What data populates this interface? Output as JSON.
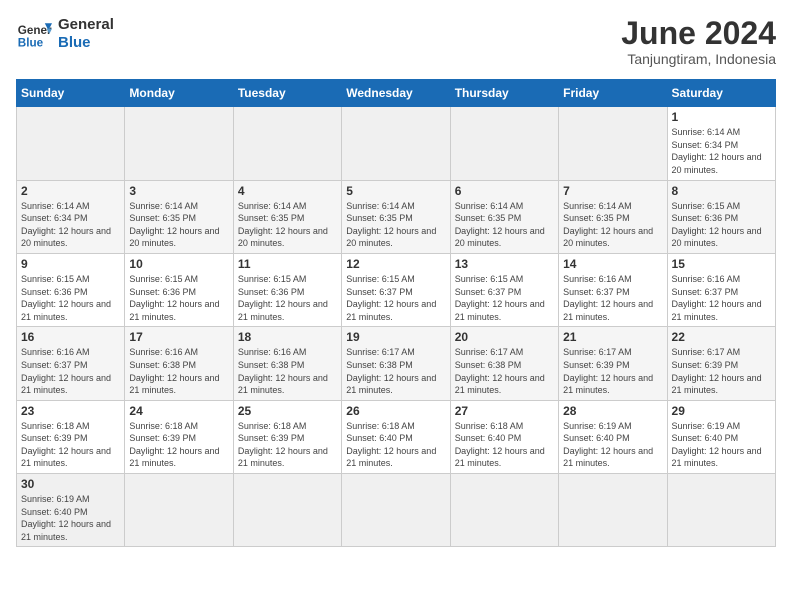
{
  "logo": {
    "general": "General",
    "blue": "Blue"
  },
  "title": "June 2024",
  "subtitle": "Tanjungtiram, Indonesia",
  "days_of_week": [
    "Sunday",
    "Monday",
    "Tuesday",
    "Wednesday",
    "Thursday",
    "Friday",
    "Saturday"
  ],
  "weeks": [
    {
      "days": [
        {
          "num": "",
          "info": ""
        },
        {
          "num": "",
          "info": ""
        },
        {
          "num": "",
          "info": ""
        },
        {
          "num": "",
          "info": ""
        },
        {
          "num": "",
          "info": ""
        },
        {
          "num": "",
          "info": ""
        },
        {
          "num": "1",
          "info": "Sunrise: 6:14 AM\nSunset: 6:34 PM\nDaylight: 12 hours and 20 minutes."
        }
      ]
    },
    {
      "days": [
        {
          "num": "2",
          "info": "Sunrise: 6:14 AM\nSunset: 6:34 PM\nDaylight: 12 hours and 20 minutes."
        },
        {
          "num": "3",
          "info": "Sunrise: 6:14 AM\nSunset: 6:35 PM\nDaylight: 12 hours and 20 minutes."
        },
        {
          "num": "4",
          "info": "Sunrise: 6:14 AM\nSunset: 6:35 PM\nDaylight: 12 hours and 20 minutes."
        },
        {
          "num": "5",
          "info": "Sunrise: 6:14 AM\nSunset: 6:35 PM\nDaylight: 12 hours and 20 minutes."
        },
        {
          "num": "6",
          "info": "Sunrise: 6:14 AM\nSunset: 6:35 PM\nDaylight: 12 hours and 20 minutes."
        },
        {
          "num": "7",
          "info": "Sunrise: 6:14 AM\nSunset: 6:35 PM\nDaylight: 12 hours and 20 minutes."
        },
        {
          "num": "8",
          "info": "Sunrise: 6:15 AM\nSunset: 6:36 PM\nDaylight: 12 hours and 20 minutes."
        }
      ]
    },
    {
      "days": [
        {
          "num": "9",
          "info": "Sunrise: 6:15 AM\nSunset: 6:36 PM\nDaylight: 12 hours and 21 minutes."
        },
        {
          "num": "10",
          "info": "Sunrise: 6:15 AM\nSunset: 6:36 PM\nDaylight: 12 hours and 21 minutes."
        },
        {
          "num": "11",
          "info": "Sunrise: 6:15 AM\nSunset: 6:36 PM\nDaylight: 12 hours and 21 minutes."
        },
        {
          "num": "12",
          "info": "Sunrise: 6:15 AM\nSunset: 6:37 PM\nDaylight: 12 hours and 21 minutes."
        },
        {
          "num": "13",
          "info": "Sunrise: 6:15 AM\nSunset: 6:37 PM\nDaylight: 12 hours and 21 minutes."
        },
        {
          "num": "14",
          "info": "Sunrise: 6:16 AM\nSunset: 6:37 PM\nDaylight: 12 hours and 21 minutes."
        },
        {
          "num": "15",
          "info": "Sunrise: 6:16 AM\nSunset: 6:37 PM\nDaylight: 12 hours and 21 minutes."
        }
      ]
    },
    {
      "days": [
        {
          "num": "16",
          "info": "Sunrise: 6:16 AM\nSunset: 6:37 PM\nDaylight: 12 hours and 21 minutes."
        },
        {
          "num": "17",
          "info": "Sunrise: 6:16 AM\nSunset: 6:38 PM\nDaylight: 12 hours and 21 minutes."
        },
        {
          "num": "18",
          "info": "Sunrise: 6:16 AM\nSunset: 6:38 PM\nDaylight: 12 hours and 21 minutes."
        },
        {
          "num": "19",
          "info": "Sunrise: 6:17 AM\nSunset: 6:38 PM\nDaylight: 12 hours and 21 minutes."
        },
        {
          "num": "20",
          "info": "Sunrise: 6:17 AM\nSunset: 6:38 PM\nDaylight: 12 hours and 21 minutes."
        },
        {
          "num": "21",
          "info": "Sunrise: 6:17 AM\nSunset: 6:39 PM\nDaylight: 12 hours and 21 minutes."
        },
        {
          "num": "22",
          "info": "Sunrise: 6:17 AM\nSunset: 6:39 PM\nDaylight: 12 hours and 21 minutes."
        }
      ]
    },
    {
      "days": [
        {
          "num": "23",
          "info": "Sunrise: 6:18 AM\nSunset: 6:39 PM\nDaylight: 12 hours and 21 minutes."
        },
        {
          "num": "24",
          "info": "Sunrise: 6:18 AM\nSunset: 6:39 PM\nDaylight: 12 hours and 21 minutes."
        },
        {
          "num": "25",
          "info": "Sunrise: 6:18 AM\nSunset: 6:39 PM\nDaylight: 12 hours and 21 minutes."
        },
        {
          "num": "26",
          "info": "Sunrise: 6:18 AM\nSunset: 6:40 PM\nDaylight: 12 hours and 21 minutes."
        },
        {
          "num": "27",
          "info": "Sunrise: 6:18 AM\nSunset: 6:40 PM\nDaylight: 12 hours and 21 minutes."
        },
        {
          "num": "28",
          "info": "Sunrise: 6:19 AM\nSunset: 6:40 PM\nDaylight: 12 hours and 21 minutes."
        },
        {
          "num": "29",
          "info": "Sunrise: 6:19 AM\nSunset: 6:40 PM\nDaylight: 12 hours and 21 minutes."
        }
      ]
    },
    {
      "days": [
        {
          "num": "30",
          "info": "Sunrise: 6:19 AM\nSunset: 6:40 PM\nDaylight: 12 hours and 21 minutes."
        },
        {
          "num": "",
          "info": ""
        },
        {
          "num": "",
          "info": ""
        },
        {
          "num": "",
          "info": ""
        },
        {
          "num": "",
          "info": ""
        },
        {
          "num": "",
          "info": ""
        },
        {
          "num": "",
          "info": ""
        }
      ]
    }
  ]
}
